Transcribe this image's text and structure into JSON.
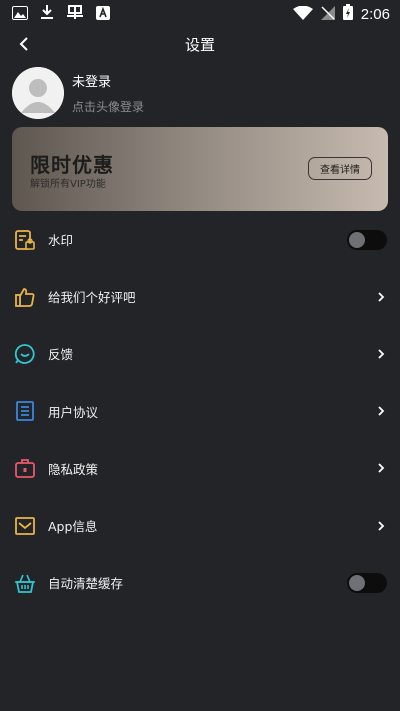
{
  "status_bar": {
    "time": "2:06"
  },
  "header": {
    "title": "设置"
  },
  "profile": {
    "name": "未登录",
    "hint": "点击头像登录"
  },
  "promo": {
    "title": "限时优惠",
    "subtitle": "解锁所有VIP功能",
    "button": "查看详情"
  },
  "menu": {
    "items": [
      {
        "label": "水印",
        "icon": "watermark-icon",
        "control": "toggle",
        "on": false,
        "icon_color": "#e8b54a"
      },
      {
        "label": "给我们个好评吧",
        "icon": "thumbs-up-icon",
        "control": "chevron",
        "icon_color": "#e8b54a"
      },
      {
        "label": "反馈",
        "icon": "feedback-smile-icon",
        "control": "chevron",
        "icon_color": "#2fc6d0"
      },
      {
        "label": "用户协议",
        "icon": "document-list-icon",
        "control": "chevron",
        "icon_color": "#3a86e0"
      },
      {
        "label": "隐私政策",
        "icon": "privacy-briefcase-icon",
        "control": "chevron",
        "icon_color": "#e65a6b"
      },
      {
        "label": "App信息",
        "icon": "app-info-envelope-icon",
        "control": "chevron",
        "icon_color": "#e8b54a"
      },
      {
        "label": "自动清楚缓存",
        "icon": "clean-basket-icon",
        "control": "toggle",
        "on": false,
        "icon_color": "#2fc6d0"
      }
    ]
  }
}
